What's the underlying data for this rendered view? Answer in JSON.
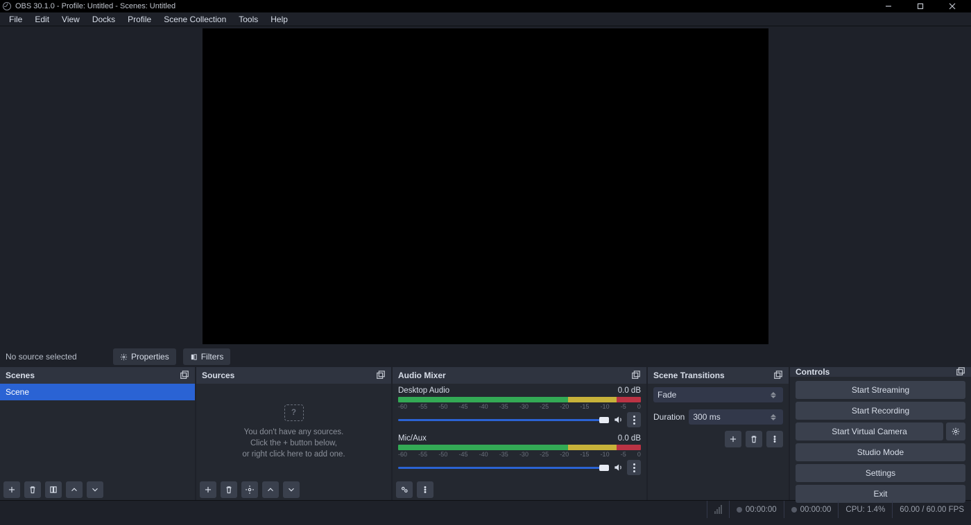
{
  "window": {
    "title": "OBS 30.1.0 - Profile: Untitled - Scenes: Untitled"
  },
  "menu": {
    "items": [
      "File",
      "Edit",
      "View",
      "Docks",
      "Profile",
      "Scene Collection",
      "Tools",
      "Help"
    ]
  },
  "source_toolbar": {
    "status": "No source selected",
    "properties": "Properties",
    "filters": "Filters"
  },
  "docks": {
    "scenes": {
      "title": "Scenes",
      "items": [
        "Scene"
      ]
    },
    "sources": {
      "title": "Sources",
      "empty_line1": "You don't have any sources.",
      "empty_line2": "Click the + button below,",
      "empty_line3": "or right click here to add one."
    },
    "mixer": {
      "title": "Audio Mixer",
      "ticks": [
        "-60",
        "-55",
        "-50",
        "-45",
        "-40",
        "-35",
        "-30",
        "-25",
        "-20",
        "-15",
        "-10",
        "-5",
        "0"
      ],
      "channels": [
        {
          "name": "Desktop Audio",
          "level": "0.0 dB"
        },
        {
          "name": "Mic/Aux",
          "level": "0.0 dB"
        }
      ]
    },
    "transitions": {
      "title": "Scene Transitions",
      "selected": "Fade",
      "duration_label": "Duration",
      "duration_value": "300 ms"
    },
    "controls": {
      "title": "Controls",
      "start_streaming": "Start Streaming",
      "start_recording": "Start Recording",
      "start_vcam": "Start Virtual Camera",
      "studio_mode": "Studio Mode",
      "settings": "Settings",
      "exit": "Exit"
    }
  },
  "status": {
    "live_time": "00:00:00",
    "rec_time": "00:00:00",
    "cpu": "CPU: 1.4%",
    "fps": "60.00 / 60.00 FPS"
  }
}
